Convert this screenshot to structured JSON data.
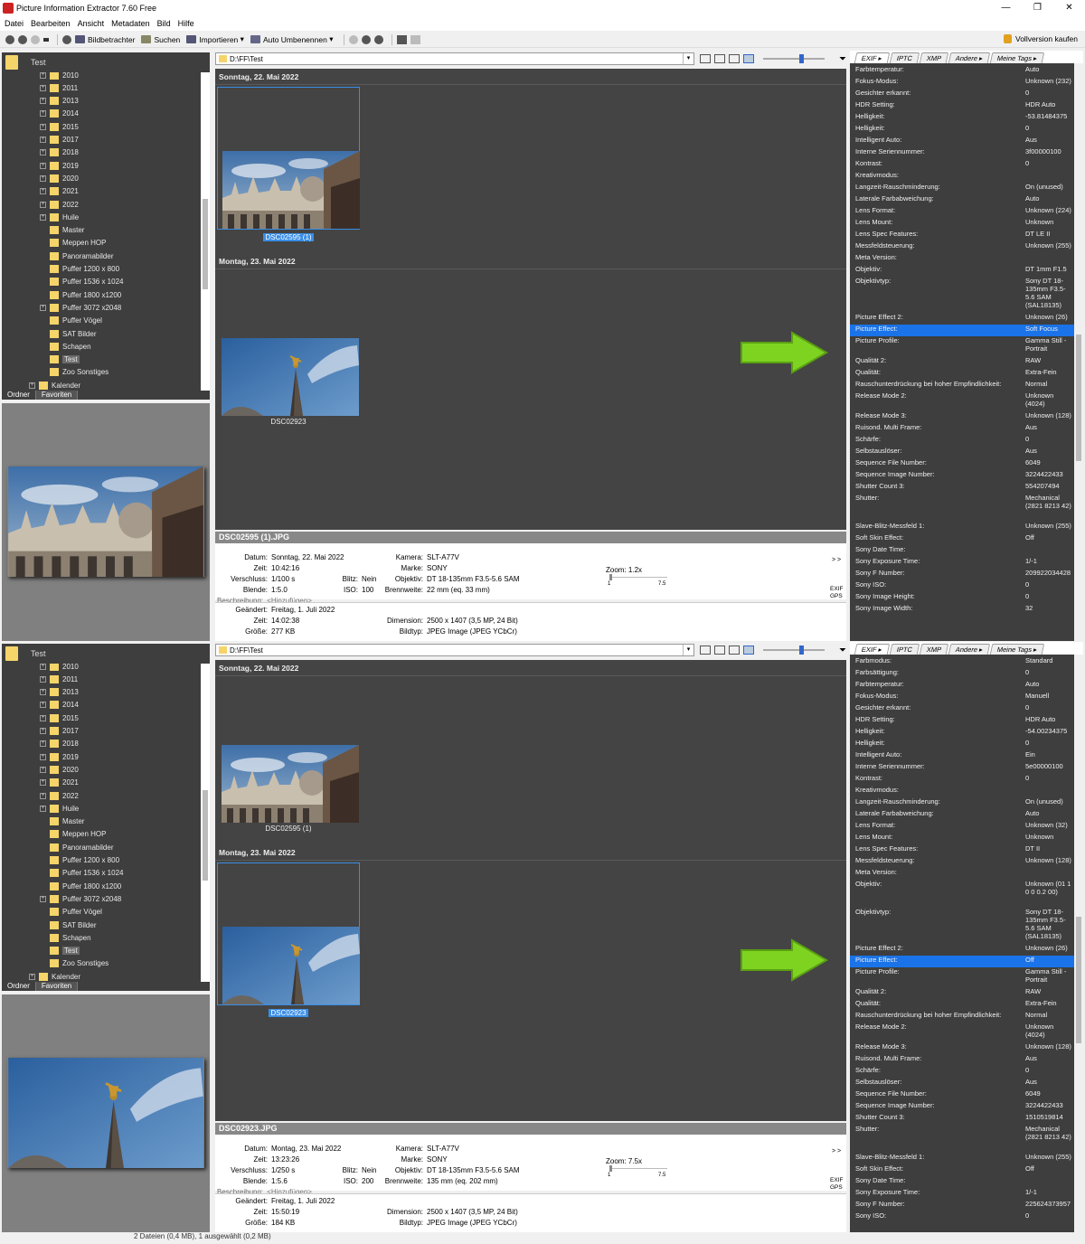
{
  "window": {
    "title": "Picture Information Extractor 7.60 Free",
    "controls": [
      "—",
      "❐",
      "✕"
    ]
  },
  "menu": [
    "Datei",
    "Bearbeiten",
    "Ansicht",
    "Metadaten",
    "Bild",
    "Hilfe"
  ],
  "toolbar": {
    "viewer": "Bildbetrachter",
    "search": "Suchen",
    "import": "Importieren",
    "rename": "Auto Umbenennen",
    "buy": "Vollversion kaufen"
  },
  "folder_title": "Test",
  "path": "D:\\FF\\Test",
  "tree": [
    {
      "label": "2010",
      "exp": true
    },
    {
      "label": "2011",
      "exp": true
    },
    {
      "label": "2013",
      "exp": true
    },
    {
      "label": "2014",
      "exp": true
    },
    {
      "label": "2015",
      "exp": true
    },
    {
      "label": "2017",
      "exp": true
    },
    {
      "label": "2018",
      "exp": true
    },
    {
      "label": "2019",
      "exp": true
    },
    {
      "label": "2020",
      "exp": true
    },
    {
      "label": "2021",
      "exp": true
    },
    {
      "label": "2022",
      "exp": true
    },
    {
      "label": "Huile",
      "exp": true
    },
    {
      "label": "Master",
      "exp": false
    },
    {
      "label": "Meppen HOP",
      "exp": false
    },
    {
      "label": "Panoramabilder",
      "exp": false
    },
    {
      "label": "Puffer 1200 x 800",
      "exp": false
    },
    {
      "label": "Puffer 1536 x 1024",
      "exp": false
    },
    {
      "label": "Puffer 1800 x1200",
      "exp": false
    },
    {
      "label": "Puffer 3072 x2048",
      "exp": true
    },
    {
      "label": "Puffer Vögel",
      "exp": false
    },
    {
      "label": "SAT Bilder",
      "exp": false
    },
    {
      "label": "Schapen",
      "exp": false
    },
    {
      "label": "Test",
      "exp": false,
      "selected": true
    },
    {
      "label": "Zoo Sonstiges",
      "exp": false
    },
    {
      "label": "Kalender",
      "exp": true,
      "level": 0
    }
  ],
  "tree_tabs": [
    "Ordner",
    "Favoriten"
  ],
  "exif_tabs": [
    "EXIF ▸",
    "IPTC",
    "XMP",
    "Andere ▸",
    "Meine Tags ▸"
  ],
  "date_headers": [
    "Sonntag, 22. Mai 2022",
    "Montag, 23. Mai 2022"
  ],
  "labels": {
    "datum": "Datum:",
    "zeit": "Zeit:",
    "verschluss": "Verschluss:",
    "blende": "Blende:",
    "blitz": "Blitz:",
    "iso": "ISO:",
    "kamera": "Kamera:",
    "marke": "Marke:",
    "objektiv": "Objektiv:",
    "brennweite": "Brennweite:",
    "beschreibung": "Beschreibung:",
    "geaendert": "Geändert:",
    "groesse": "Größe:",
    "dimension": "Dimension:",
    "bildtyp": "Bildtyp:",
    "zoom_min": "1",
    "zoom_max": "7.5",
    "expand": "> >",
    "exif_gps_1": "EXIF",
    "exif_gps_2": "GPS"
  },
  "panels": [
    {
      "thumbs": [
        {
          "caption": "DSC02595 (1)",
          "selected": true
        },
        {
          "caption": "DSC02923",
          "selected": false
        }
      ],
      "file": "DSC02595 (1).JPG",
      "datum": "Sonntag, 22. Mai 2022",
      "zeit": "10:42:16",
      "verschluss": "1/100 s",
      "blitz": "Nein",
      "blende": "1:5.0",
      "iso": "100",
      "kamera": "SLT-A77V",
      "marke": "SONY",
      "objektiv": "DT 18-135mm F3.5-5.6 SAM",
      "brennweite": "22 mm (eq. 33 mm)",
      "zoom": "Zoom: 1.2x",
      "beschreibung": "<Hinzufügen>",
      "geaendert": "Freitag, 1. Juli 2022",
      "zeit2": "14:02:38",
      "groesse": "277 KB",
      "dimension": "2500 x 1407 (3,5 MP, 24 Bit)",
      "bildtyp": "JPEG Image (JPEG YCbCr)",
      "exif": [
        [
          "Farbtemperatur:",
          "Auto"
        ],
        [
          "Fokus-Modus:",
          "Unknown (232)"
        ],
        [
          "Gesichter erkannt:",
          "0"
        ],
        [
          "HDR Setting:",
          "HDR Auto"
        ],
        [
          "Helligkeit:",
          "-53.81484375"
        ],
        [
          "Helligkeit:",
          "0"
        ],
        [
          "Intelligent Auto:",
          "Aus"
        ],
        [
          "Interne Seriennummer:",
          "3f00000100"
        ],
        [
          "Kontrast:",
          "0"
        ],
        [
          "Kreativmodus:",
          ""
        ],
        [
          "Langzeit-Rauschminderung:",
          "On (unused)"
        ],
        [
          "Laterale Farbabweichung:",
          "Auto"
        ],
        [
          "Lens Format:",
          "Unknown (224)"
        ],
        [
          "Lens Mount:",
          "Unknown"
        ],
        [
          "Lens Spec Features:",
          "DT LE II"
        ],
        [
          "Messfeldsteuerung:",
          "Unknown (255)"
        ],
        [
          "Meta Version:",
          ""
        ],
        [
          "Objektiv:",
          "DT 1mm F1.5"
        ],
        [
          "Objektivtyp:",
          "Sony DT 18-135mm F3.5-5.6 SAM (SAL18135)"
        ],
        [
          "Picture Effect 2:",
          "Unknown (26)"
        ],
        [
          "Picture Effect:",
          "Soft Focus"
        ],
        [
          "Picture Profile:",
          "Gamma Still - Portrait"
        ],
        [
          "Qualität 2:",
          "RAW"
        ],
        [
          "Qualität:",
          "Extra-Fein"
        ],
        [
          "Rauschunterdrückung bei hoher Empfindlichkeit:",
          "Normal"
        ],
        [
          "Release Mode 2:",
          "Unknown (4024)"
        ],
        [
          "Release Mode 3:",
          "Unknown (128)"
        ],
        [
          "Ruisond. Multi Frame:",
          "Aus"
        ],
        [
          "Schärfe:",
          "0"
        ],
        [
          "Selbstauslöser:",
          "Aus"
        ],
        [
          "Sequence File Number:",
          "6049"
        ],
        [
          "Sequence Image Number:",
          "3224422433"
        ],
        [
          "Shutter Count 3:",
          "554207494"
        ],
        [
          "Shutter:",
          "Mechanical (2821 8213 42)"
        ],
        [
          "Slave-Blitz-Messfeld 1:",
          "Unknown (255)"
        ],
        [
          "Soft Skin Effect:",
          "Off"
        ],
        [
          "Sony Date Time:",
          ""
        ],
        [
          "Sony Exposure Time:",
          "1/-1"
        ],
        [
          "Sony F Number:",
          "209922034428"
        ],
        [
          "Sony ISO:",
          "0"
        ],
        [
          "Sony Image Height:",
          "0"
        ],
        [
          "Sony Image Width:",
          "32"
        ]
      ]
    },
    {
      "thumbs": [
        {
          "caption": "DSC02595 (1)",
          "selected": false
        },
        {
          "caption": "DSC02923",
          "selected": true
        }
      ],
      "file": "DSC02923.JPG",
      "datum": "Montag, 23. Mai 2022",
      "zeit": "13:23:26",
      "verschluss": "1/250 s",
      "blitz": "Nein",
      "blende": "1:5.6",
      "iso": "200",
      "kamera": "SLT-A77V",
      "marke": "SONY",
      "objektiv": "DT 18-135mm F3.5-5.6 SAM",
      "brennweite": "135 mm (eq. 202 mm)",
      "zoom": "Zoom: 7.5x",
      "beschreibung": "<Hinzufügen>",
      "geaendert": "Freitag, 1. Juli 2022",
      "zeit2": "15:50:19",
      "groesse": "184 KB",
      "dimension": "2500 x 1407 (3,5 MP, 24 Bit)",
      "bildtyp": "JPEG Image (JPEG YCbCr)",
      "exif": [
        [
          "Farbmodus:",
          "Standard"
        ],
        [
          "Farbsättigung:",
          "0"
        ],
        [
          "Farbtemperatur:",
          "Auto"
        ],
        [
          "Fokus-Modus:",
          "Manuell"
        ],
        [
          "Gesichter erkannt:",
          "0"
        ],
        [
          "HDR Setting:",
          "HDR Auto"
        ],
        [
          "Helligkeit:",
          "-54.00234375"
        ],
        [
          "Helligkeit:",
          "0"
        ],
        [
          "Intelligent Auto:",
          "Ein"
        ],
        [
          "Interne Seriennummer:",
          "5e00000100"
        ],
        [
          "Kontrast:",
          "0"
        ],
        [
          "Kreativmodus:",
          ""
        ],
        [
          "Langzeit-Rauschminderung:",
          "On (unused)"
        ],
        [
          "Laterale Farbabweichung:",
          "Auto"
        ],
        [
          "Lens Format:",
          "Unknown (32)"
        ],
        [
          "Lens Mount:",
          "Unknown"
        ],
        [
          "Lens Spec Features:",
          "DT II"
        ],
        [
          "Messfeldsteuerung:",
          "Unknown (128)"
        ],
        [
          "Meta Version:",
          ""
        ],
        [
          "Objektiv:",
          "Unknown (01 1 0 0 0.2 00)"
        ],
        [
          "Objektivtyp:",
          "Sony DT 18-135mm F3.5-5.6 SAM (SAL18135)"
        ],
        [
          "Picture Effect 2:",
          "Unknown (26)"
        ],
        [
          "Picture Effect:",
          "Off"
        ],
        [
          "Picture Profile:",
          "Gamma Still - Portrait"
        ],
        [
          "Qualität 2:",
          "RAW"
        ],
        [
          "Qualität:",
          "Extra-Fein"
        ],
        [
          "Rauschunterdrückung bei hoher Empfindlichkeit:",
          "Normal"
        ],
        [
          "Release Mode 2:",
          "Unknown (4024)"
        ],
        [
          "Release Mode 3:",
          "Unknown (128)"
        ],
        [
          "Ruisond. Multi Frame:",
          "Aus"
        ],
        [
          "Schärfe:",
          "0"
        ],
        [
          "Selbstauslöser:",
          "Aus"
        ],
        [
          "Sequence File Number:",
          "6049"
        ],
        [
          "Sequence Image Number:",
          "3224422433"
        ],
        [
          "Shutter Count 3:",
          "1510519814"
        ],
        [
          "Shutter:",
          "Mechanical (2821 8213 42)"
        ],
        [
          "Slave-Blitz-Messfeld 1:",
          "Unknown (255)"
        ],
        [
          "Soft Skin Effect:",
          "Off"
        ],
        [
          "Sony Date Time:",
          ""
        ],
        [
          "Sony Exposure Time:",
          "1/-1"
        ],
        [
          "Sony F Number:",
          "225624373957"
        ],
        [
          "Sony ISO:",
          "0"
        ]
      ]
    }
  ],
  "status": "2 Dateien (0,4 MB), 1 ausgewählt (0,2 MB)",
  "colors": {
    "dark_panel": "#3e3e3e",
    "gallery": "#444444",
    "highlight": "#1a73e8",
    "arrow": "#7ed321"
  },
  "icons": [
    "back-icon",
    "forward-icon",
    "refresh-icon",
    "settings-icon",
    "viewer-icon",
    "search-icon",
    "import-icon",
    "rename-icon",
    "lock-icon",
    "folder-icon",
    "filter-icon",
    "arrow-icon"
  ]
}
